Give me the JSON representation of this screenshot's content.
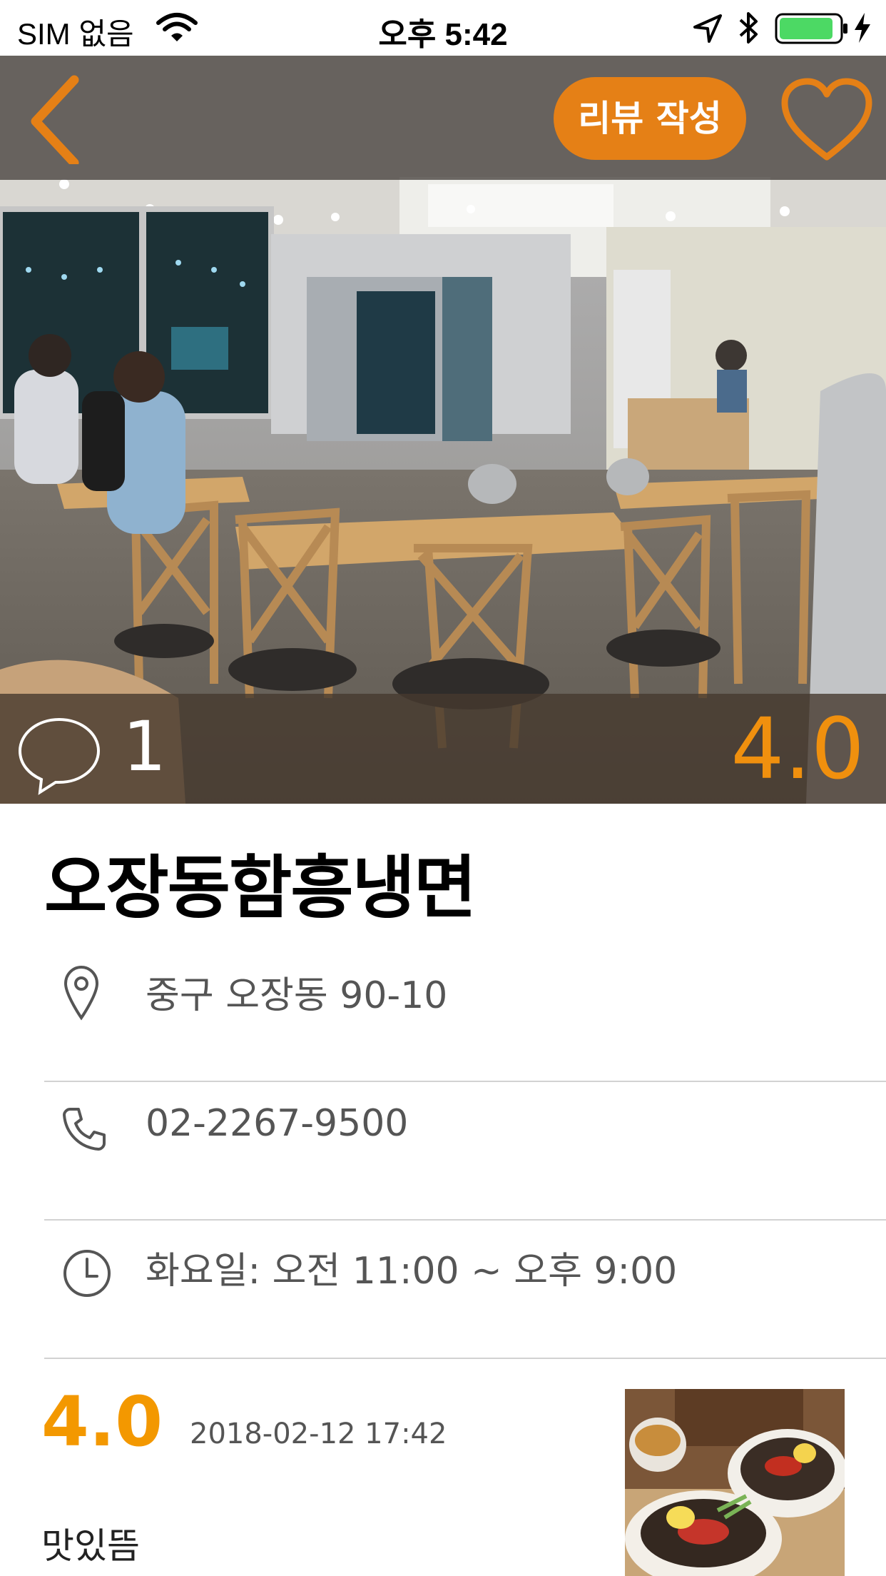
{
  "status_bar": {
    "carrier": "SIM 없음",
    "time": "오후 5:42",
    "icons": [
      "wifi-icon",
      "location-arrow-icon",
      "bluetooth-icon",
      "battery-icon",
      "charging-bolt-icon"
    ]
  },
  "header": {
    "review_button_label": "리뷰 작성",
    "back_icon": "chevron-left-icon",
    "favorite_icon": "heart-outline-icon"
  },
  "hero": {
    "comment_count": "1",
    "rating": "4.0"
  },
  "restaurant": {
    "name": "오장동함흥냉면",
    "address": "중구 오장동 90-10",
    "phone": "02-2267-9500",
    "hours": "화요일: 오전 11:00 ~ 오후 9:00"
  },
  "review": {
    "rating": "4.0",
    "date": "2018-02-12 17:42",
    "text": "맛있뜸"
  },
  "colors": {
    "accent": "#e58016",
    "rating": "#f39800",
    "info_text": "#555555",
    "divider": "#d2d2d2"
  }
}
